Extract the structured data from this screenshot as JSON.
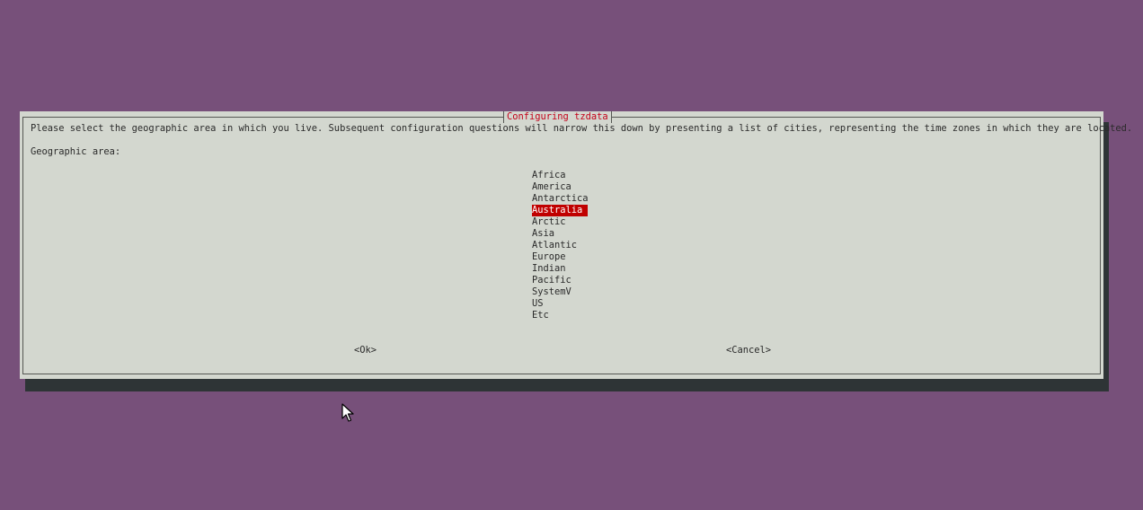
{
  "dialog": {
    "title": "Configuring tzdata",
    "message": "Please select the geographic area in which you live. Subsequent configuration questions will narrow this down by presenting a list of cities, representing the time zones in which they are located.",
    "field_label": "Geographic area:",
    "options": [
      "Africa",
      "America",
      "Antarctica",
      "Australia",
      "Arctic",
      "Asia",
      "Atlantic",
      "Europe",
      "Indian",
      "Pacific",
      "SystemV",
      "US",
      "Etc"
    ],
    "selected_index": 3,
    "ok_label": "<Ok>",
    "cancel_label": "<Cancel>"
  },
  "colors": {
    "desktop_background": "#77507a",
    "dialog_background": "#d3d7cf",
    "title_text": "#c4001a",
    "selection_background": "#c00000",
    "shadow": "#2e3436"
  },
  "icons": {
    "mouse_cursor": "arrow-pointer-icon"
  }
}
